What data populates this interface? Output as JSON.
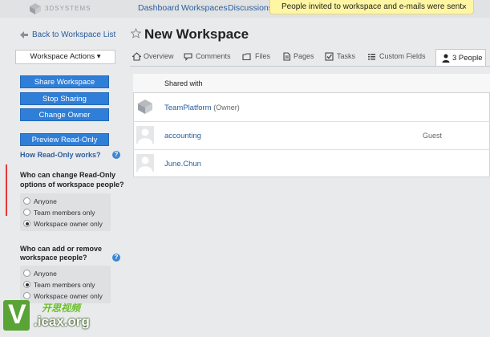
{
  "header": {
    "logo_text": "3DSYSTEMS",
    "nav": [
      "Dashboard",
      "Workspaces",
      "Discussions"
    ],
    "toast": "People invited to workspace and e-mails were sent.",
    "toast_close": "×"
  },
  "back_link": "Back to Workspace List",
  "page_title": "New Workspace",
  "workspace_actions": "Workspace Actions ▾",
  "tabs": [
    "Overview",
    "Comments",
    "Files",
    "Pages",
    "Tasks",
    "Custom Fields"
  ],
  "active_tab": "3 People",
  "buttons": {
    "share": "Share Workspace",
    "stop": "Stop Sharing",
    "change_owner": "Change Owner",
    "preview": "Preview Read-Only"
  },
  "how_readonly": "How Read-Only works?",
  "section1": {
    "title_line1": "Who can change Read-Only",
    "title_line2": "options of workspace people?",
    "options": [
      "Anyone",
      "Team members only",
      "Workspace owner only"
    ],
    "selected": 2
  },
  "section2": {
    "title_line1": "Who can add or remove",
    "title_line2": "workspace people?",
    "options": [
      "Anyone",
      "Team members only",
      "Workspace owner only"
    ],
    "selected": 1
  },
  "table": {
    "header": "Shared with",
    "rows": [
      {
        "name": "TeamPlatform",
        "role": "(Owner)",
        "access": ""
      },
      {
        "name": "accounting",
        "role": "",
        "access": "Guest"
      },
      {
        "name": "June.Chun",
        "role": "",
        "access": ""
      }
    ]
  },
  "watermark": {
    "letter": "V",
    "cn": "开思视频",
    "url": ".icax.org"
  }
}
